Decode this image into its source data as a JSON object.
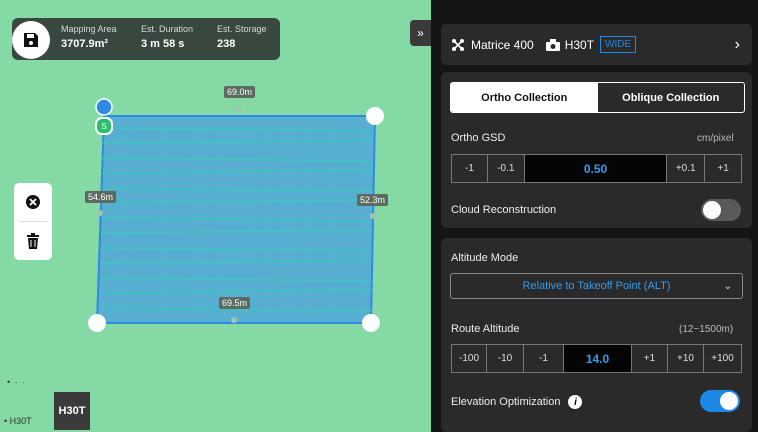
{
  "map": {
    "stats": [
      {
        "label": "Mapping Area",
        "value": "3707.9m²"
      },
      {
        "label": "Est. Duration",
        "value": "3 m 58 s"
      },
      {
        "label": "Est. Storage",
        "value": "238"
      }
    ],
    "collapse_glyph": "»",
    "measurements": {
      "top": "69.0m",
      "left": "54.6m",
      "right": "52.3m",
      "bottom": "69.5m"
    },
    "start_marker": "S",
    "camera_button": "H30T",
    "camera_indicator": "• H30T",
    "scale_dots": "• · ·",
    "colors": {
      "route": "#3aa8d8",
      "polygon": "#4a9fe0",
      "waypoint": "#2f8ae6"
    }
  },
  "panel": {
    "aircraft": "Matrice 400",
    "camera": "H30T",
    "lens": "WIDE",
    "tabs": [
      {
        "label": "Ortho Collection",
        "active": true
      },
      {
        "label": "Oblique Collection",
        "active": false
      }
    ],
    "ortho_gsd": {
      "label": "Ortho GSD",
      "unit": "cm/pixel",
      "minus1": "-1",
      "minus01": "-0.1",
      "value": "0.50",
      "plus01": "+0.1",
      "plus1": "+1"
    },
    "cloud": {
      "label": "Cloud Reconstruction",
      "enabled": false
    },
    "altitude_mode": {
      "label": "Altitude Mode",
      "value": "Relative to Takeoff Point (ALT)"
    },
    "route_altitude": {
      "label": "Route Altitude",
      "range": "(12~1500m)",
      "m100": "-100",
      "m10": "-10",
      "m1": "-1",
      "value": "14.0",
      "p1": "+1",
      "p10": "+10",
      "p100": "+100"
    },
    "elevation": {
      "label": "Elevation Optimization",
      "enabled": true
    },
    "accent": "#1e88e5"
  }
}
